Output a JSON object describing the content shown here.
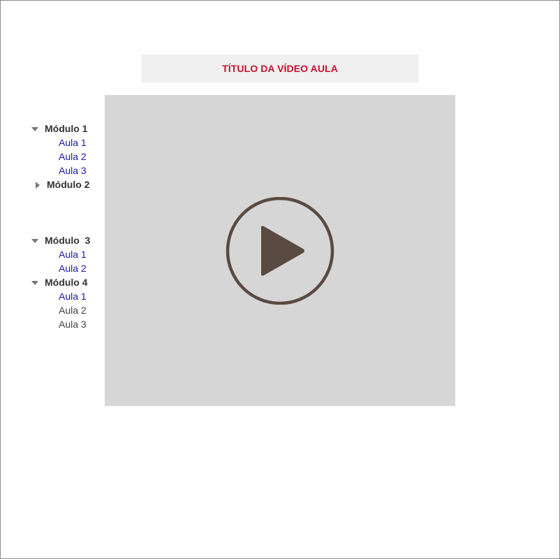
{
  "title": "TÍTULO DA VÍDEO AULA",
  "colors": {
    "title": "#c8102e",
    "title_bg": "#f0f0f0",
    "video_bg": "#d6d6d6",
    "play_icon": "#594a42",
    "lesson_link": "#1a1aa6",
    "lesson_plain": "#444444"
  },
  "video": {
    "play_icon": "play-circle-icon"
  },
  "modules": [
    {
      "label": "Módulo 1",
      "expanded": true,
      "lessons": [
        {
          "label": "Aula 1",
          "style": "link"
        },
        {
          "label": "Aula 2",
          "style": "link"
        },
        {
          "label": "Aula 3",
          "style": "link"
        }
      ]
    },
    {
      "label": "Módulo 2",
      "expanded": false,
      "lessons": []
    },
    {
      "label": "Módulo  3",
      "expanded": true,
      "lessons": [
        {
          "label": "Aula 1",
          "style": "link"
        },
        {
          "label": "Aula 2",
          "style": "link"
        }
      ]
    },
    {
      "label": "Módulo 4",
      "expanded": true,
      "lessons": [
        {
          "label": "Aula 1",
          "style": "link"
        },
        {
          "label": "Aula 2",
          "style": "plain"
        },
        {
          "label": "Aula 3",
          "style": "plain"
        }
      ]
    }
  ]
}
